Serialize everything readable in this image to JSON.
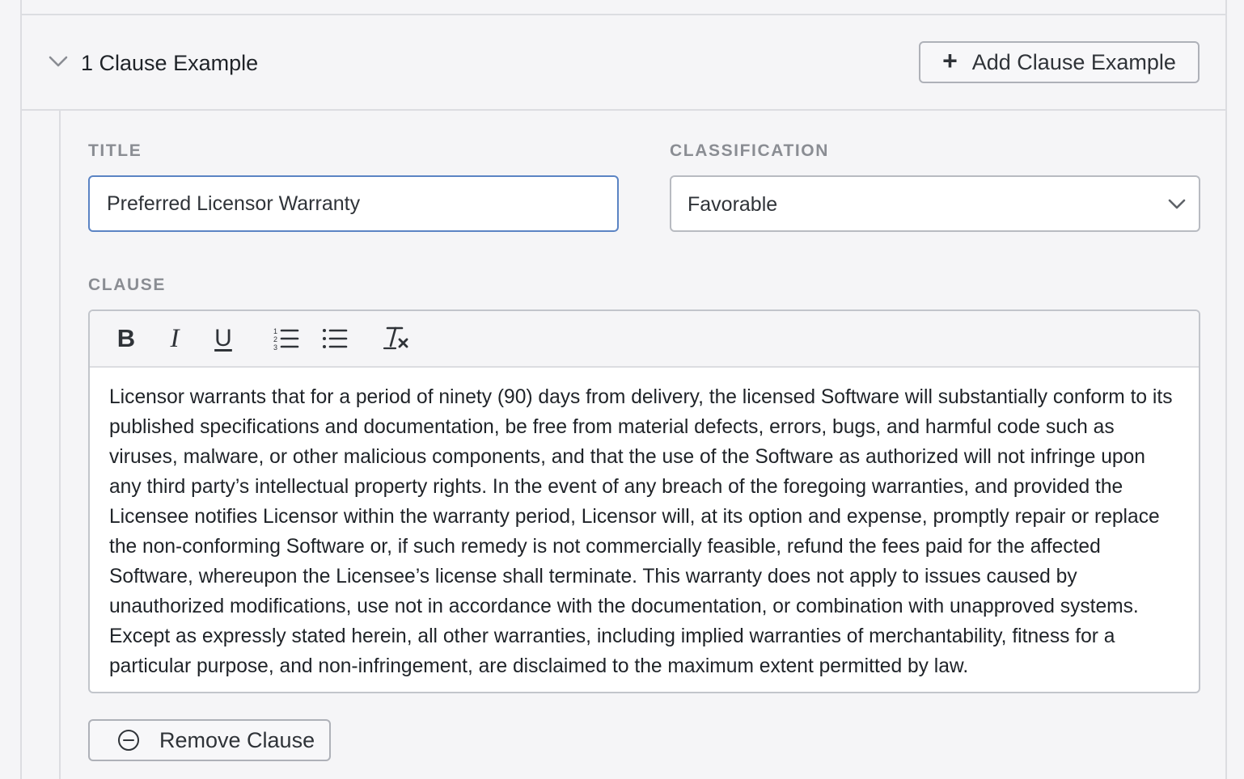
{
  "section": {
    "header": {
      "count_title": "1 Clause Example",
      "add_button_label": "Add Clause Example"
    },
    "form": {
      "title_label": "TITLE",
      "title_value": "Preferred Licensor Warranty",
      "classification_label": "CLASSIFICATION",
      "classification_value": "Favorable",
      "clause_label": "CLAUSE",
      "clause_text": "Licensor warrants that for a period of ninety (90) days from delivery, the licensed Software will substantially conform to its published specifications and documentation, be free from material defects, errors, bugs, and harmful code such as viruses, malware, or other malicious components, and that the use of the Software as authorized will not infringe upon any third party’s intellectual property rights. In the event of any breach of the foregoing warranties, and provided the Licensee notifies Licensor within the warranty period, Licensor will, at its option and expense, promptly repair or replace the non-conforming Software or, if such remedy is not commercially feasible, refund the fees paid for the affected Software, whereupon the Licensee’s license shall terminate. This warranty does not apply to issues caused by unauthorized modifications, use not in accordance with the documentation, or combination with unapproved systems. Except as expressly stated herein, all other warranties, including implied warranties of merchantability, fitness for a particular purpose, and non-infringement, are disclaimed to the maximum extent permitted by law.",
      "remove_button_label": "Remove Clause"
    },
    "toolbar": {
      "bold_glyph": "B",
      "italic_glyph": "I",
      "underline_glyph": "U",
      "icons": [
        "bold-icon",
        "italic-icon",
        "underline-icon",
        "ordered-list-icon",
        "bullet-list-icon",
        "clear-formatting-icon"
      ]
    }
  },
  "colors": {
    "background": "#f5f5f7",
    "focus_border": "#5b84c4",
    "label_gray": "#8a8d93",
    "border_gray": "#dcdde1"
  }
}
